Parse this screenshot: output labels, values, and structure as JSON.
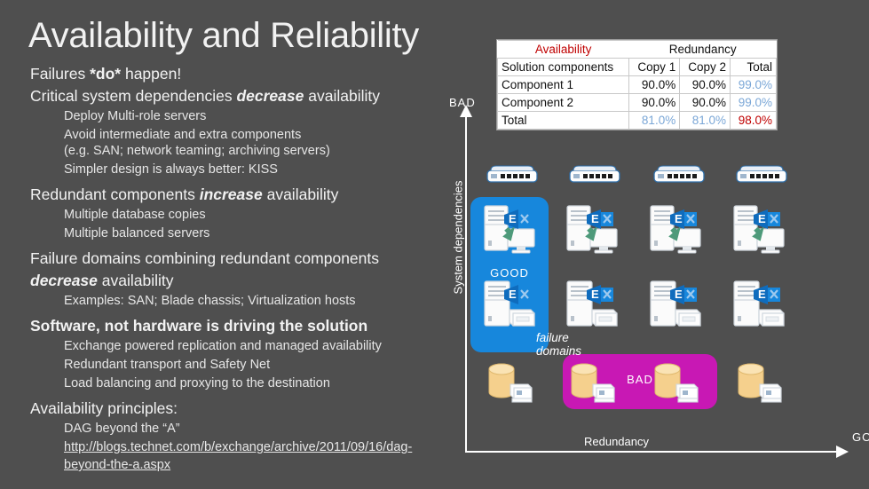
{
  "slide": {
    "title": "Availability and Reliability",
    "background_color": "#4f4f4f",
    "accent_blue": "#1787dc",
    "accent_magenta": "#c818b4",
    "accent_red": "#c00000"
  },
  "bullets": {
    "b1": "Failures *do* happen!",
    "b2_pre": "Critical system dependencies ",
    "b2_em": "decrease",
    "b2_post": " availability",
    "b2_sub1": "Deploy Multi-role servers",
    "b2_sub2a": "Avoid intermediate and extra components",
    "b2_sub2b": "(e.g. SAN; network teaming; archiving servers)",
    "b2_sub3": "Simpler design is always better: KISS",
    "b3_pre": "Redundant components ",
    "b3_em": "increase",
    "b3_post": " availability",
    "b3_sub1": "Multiple database copies",
    "b3_sub2": "Multiple balanced servers",
    "b4_line1": "Failure domains combining redundant components",
    "b4_em": "decrease",
    "b4_post": " availability",
    "b4_sub1": "Examples: SAN; Blade chassis; Virtualization hosts",
    "b5": "Software, not hardware is driving the solution",
    "b5_sub1": "Exchange powered replication and managed availability",
    "b5_sub2": "Redundant transport and Safety Net",
    "b5_sub3": "Load balancing and proxying to the destination",
    "b6": "Availability principles:",
    "b6_sub1": "DAG beyond the “A”",
    "b6_link": "http://blogs.technet.com/b/exchange/archive/2011/09/16/dag-beyond-the-a.aspx"
  },
  "table": {
    "group_header_left": "Availability",
    "group_header_right": "Redundancy",
    "columns": [
      "Solution components",
      "Copy 1",
      "Copy 2",
      "Total"
    ],
    "rows": [
      {
        "label": "Component 1",
        "copy1": "90.0%",
        "copy2": "90.0%",
        "total": "99.0%"
      },
      {
        "label": "Component 2",
        "copy1": "90.0%",
        "copy2": "90.0%",
        "total": "99.0%"
      },
      {
        "label": "Total",
        "copy1": "81.0%",
        "copy2": "81.0%",
        "total": "98.0%"
      }
    ]
  },
  "diagram": {
    "y_axis_label": "System dependencies",
    "y_axis_end_label": "BAD",
    "x_axis_label": "Redundancy",
    "x_axis_end_label": "GOOD",
    "good_box_label": "GOOD",
    "bad_box_label": "BAD",
    "failure_domains_label_line1": "failure",
    "failure_domains_label_line2": "domains",
    "rows": [
      {
        "name": "network-switch-row",
        "count": 4,
        "icon": "network-switch-icon"
      },
      {
        "name": "exchange-server-client-row",
        "count": 4,
        "icon": "exchange-server-client-icon"
      },
      {
        "name": "exchange-server-storage-row",
        "count": 4,
        "icon": "exchange-server-storage-icon"
      },
      {
        "name": "database-row",
        "count": 4,
        "icon": "database-cylinder-icon"
      }
    ]
  }
}
